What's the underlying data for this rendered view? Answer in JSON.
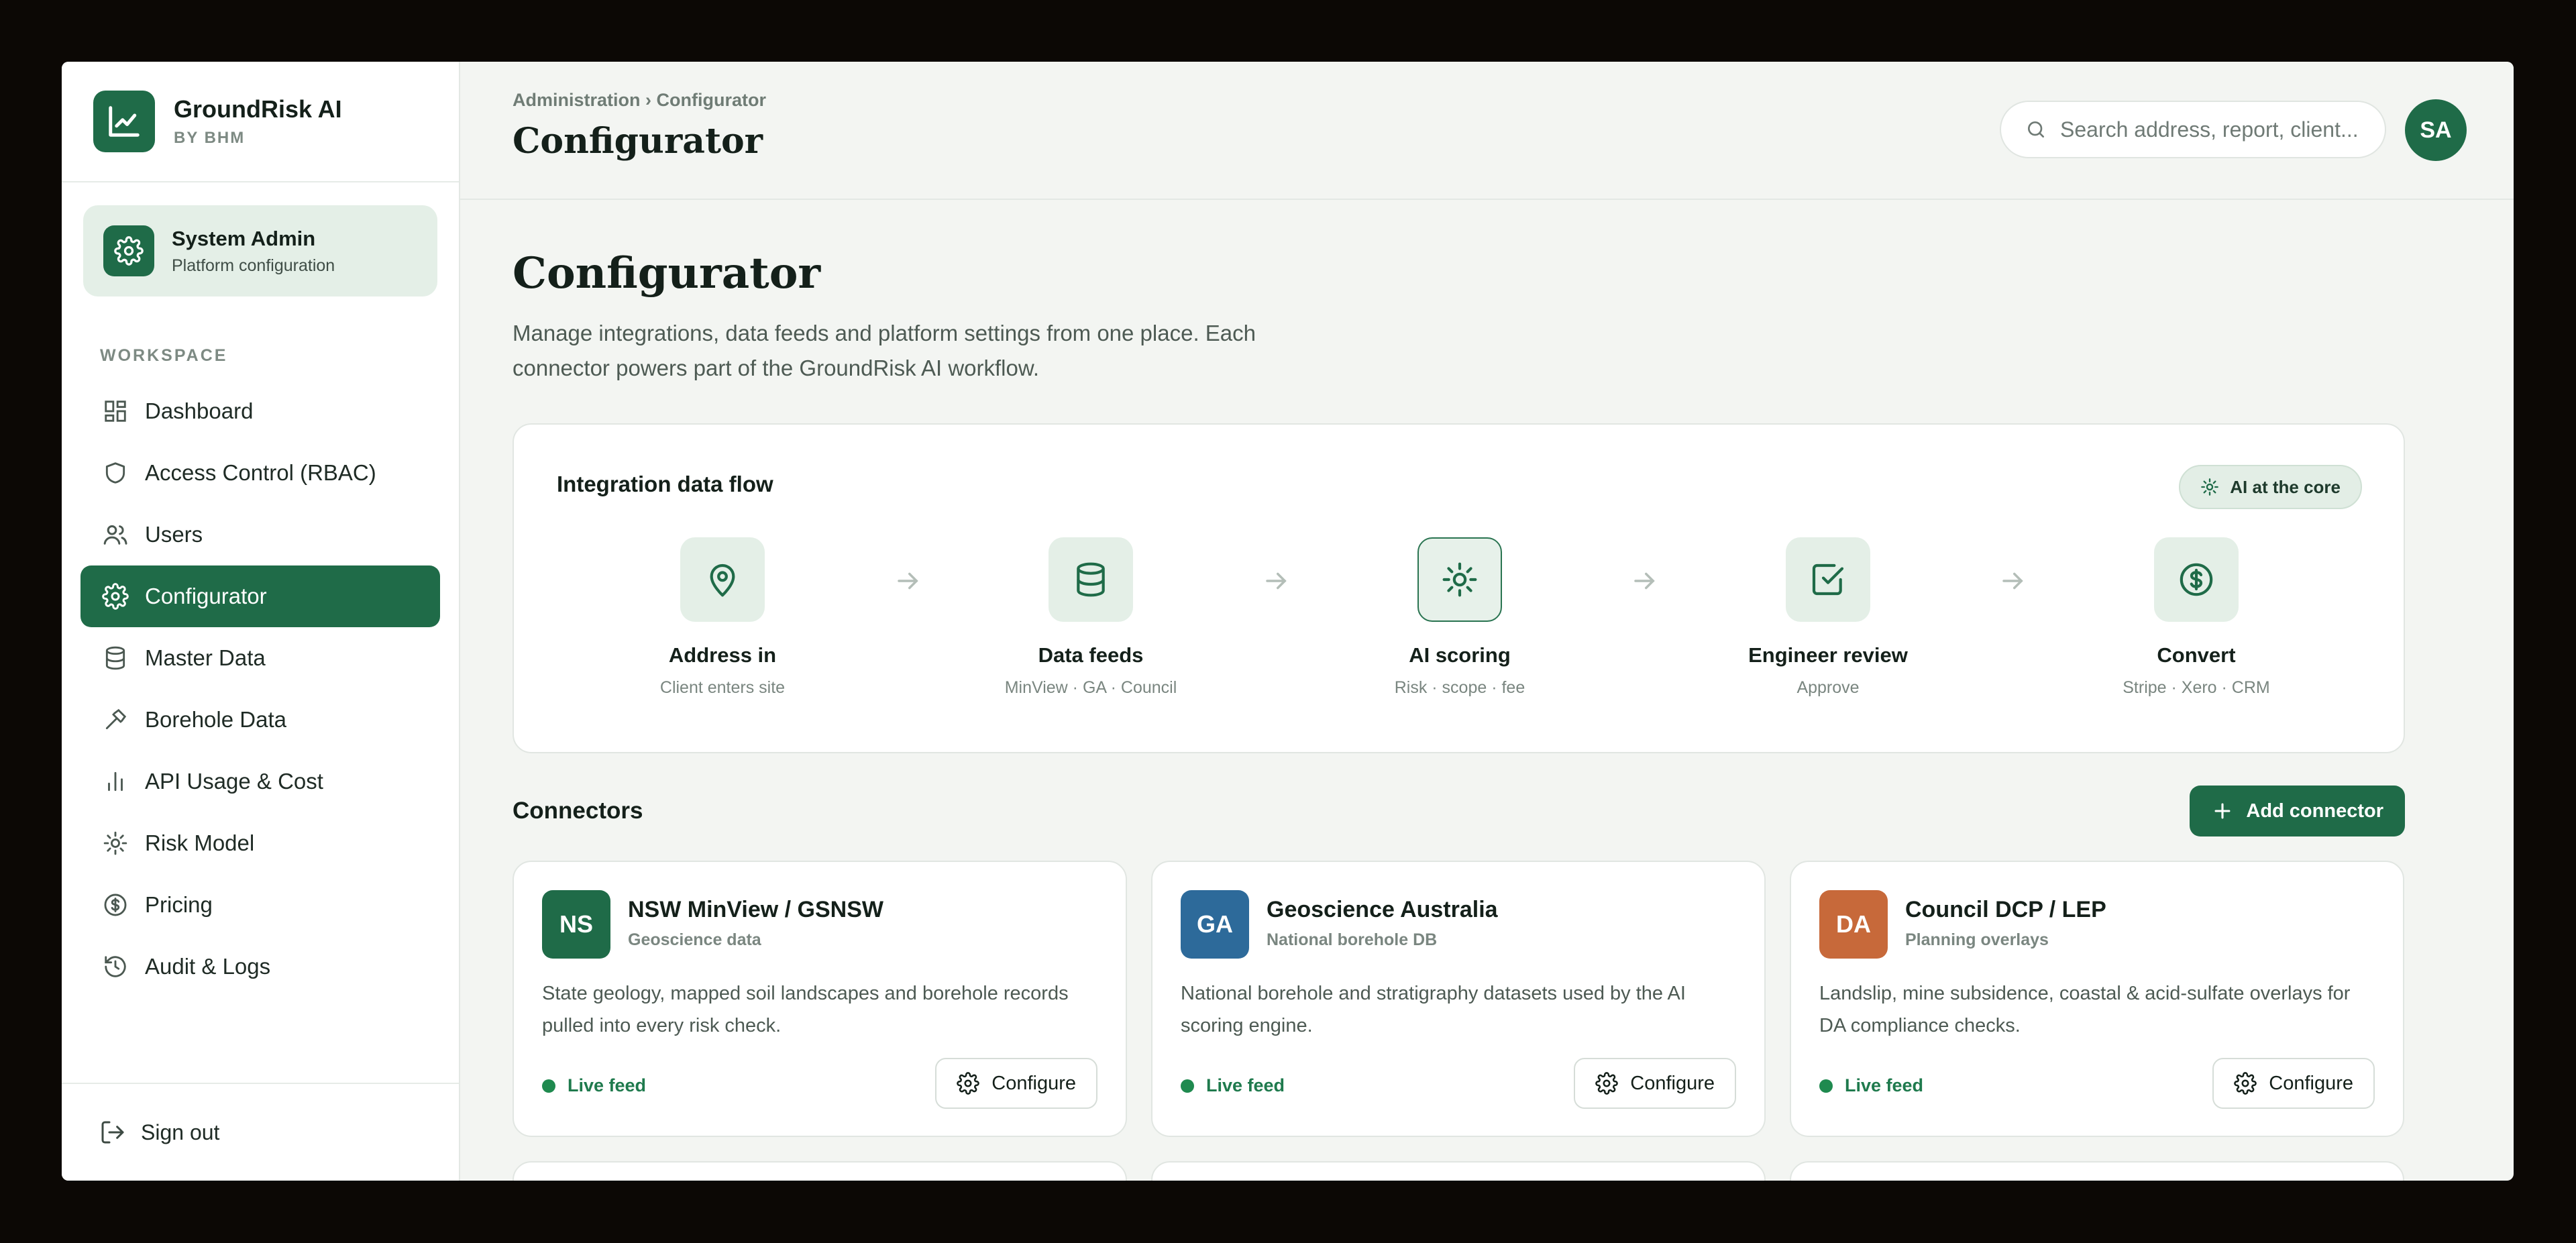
{
  "brand": {
    "name": "GroundRisk AI",
    "sub": "BY BHM"
  },
  "role": {
    "title": "System Admin",
    "sub": "Platform configuration"
  },
  "sidebar": {
    "section": "WORKSPACE",
    "items": [
      {
        "label": "Dashboard",
        "icon": "dashboard-icon"
      },
      {
        "label": "Access Control (RBAC)",
        "icon": "shield-icon"
      },
      {
        "label": "Users",
        "icon": "users-icon"
      },
      {
        "label": "Configurator",
        "icon": "gear-icon",
        "active": true
      },
      {
        "label": "Master Data",
        "icon": "database-icon"
      },
      {
        "label": "Borehole Data",
        "icon": "drill-icon"
      },
      {
        "label": "API Usage & Cost",
        "icon": "bar-chart-icon"
      },
      {
        "label": "Risk Model",
        "icon": "sun-icon"
      },
      {
        "label": "Pricing",
        "icon": "dollar-icon"
      },
      {
        "label": "Audit & Logs",
        "icon": "history-icon"
      }
    ],
    "signout": "Sign out"
  },
  "header": {
    "breadcrumb": "Administration › Configurator",
    "title": "Configurator",
    "search_placeholder": "Search address, report, client...",
    "avatar": "SA"
  },
  "page": {
    "title": "Configurator",
    "description": "Manage integrations, data feeds and platform settings from one place. Each connector powers part of the GroundRisk AI workflow."
  },
  "flow": {
    "title": "Integration data flow",
    "badge": "AI at the core",
    "steps": [
      {
        "name": "Address in",
        "sub": "Client enters site",
        "icon": "map-pin-icon"
      },
      {
        "name": "Data feeds",
        "sub": "MinView · GA · Council",
        "icon": "database-icon"
      },
      {
        "name": "AI scoring",
        "sub": "Risk · scope · fee",
        "icon": "sun-icon"
      },
      {
        "name": "Engineer review",
        "sub": "Approve",
        "icon": "check-square-icon"
      },
      {
        "name": "Convert",
        "sub": "Stripe · Xero · CRM",
        "icon": "dollar-icon"
      }
    ]
  },
  "connectors": {
    "title": "Connectors",
    "add_label": "Add connector",
    "configure_label": "Configure",
    "items": [
      {
        "badge": "NS",
        "color": "#1f6b48",
        "name": "NSW MinView / GSNSW",
        "type": "Geoscience data",
        "desc": "State geology, mapped soil landscapes and borehole records pulled into every risk check.",
        "status": "Live feed"
      },
      {
        "badge": "GA",
        "color": "#2d6a9a",
        "name": "Geoscience Australia",
        "type": "National borehole DB",
        "desc": "National borehole and stratigraphy datasets used by the AI scoring engine.",
        "status": "Live feed"
      },
      {
        "badge": "DA",
        "color": "#c7693a",
        "name": "Council DCP / LEP",
        "type": "Planning overlays",
        "desc": "Landslip, mine subsidence, coastal & acid-sulfate overlays for DA compliance checks.",
        "status": "Live feed"
      }
    ]
  },
  "colors": {
    "accent": "#1f6b48",
    "background": "#f3f5f2",
    "live": "#1f8a4f"
  }
}
